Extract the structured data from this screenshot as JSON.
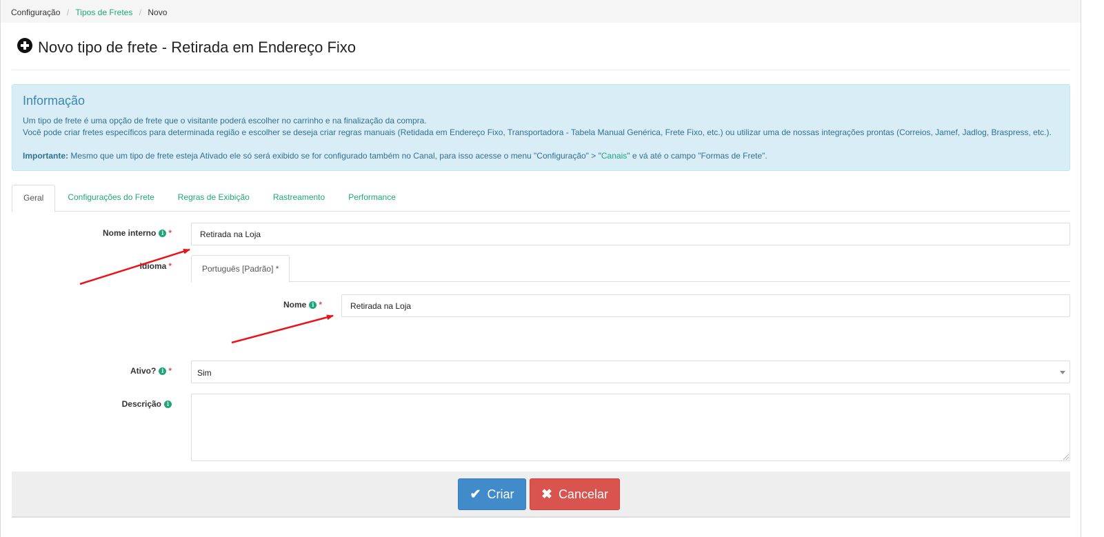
{
  "breadcrumb": {
    "items": [
      "Configuração",
      "Tipos de Fretes",
      "Novo"
    ]
  },
  "page": {
    "title": "Novo tipo de frete - Retirada em Endereço Fixo"
  },
  "info": {
    "title": "Informação",
    "line1": "Um tipo de frete é uma opção de frete que o visitante poderá escolher no carrinho e na finalização da compra.",
    "line2": "Você pode criar fretes específicos para determinada região e escolher se deseja criar regras manuais (Retidada em Endereço Fixo, Transportadora - Tabela Manual Genérica, Frete Fixo, etc.) ou utilizar uma de nossas integrações prontas (Correios, Jamef, Jadlog, Braspress, etc.).",
    "important_label": "Importante:",
    "important_text_a": " Mesmo que um tipo de frete esteja Ativado ele só será exibido se for configurado também no Canal, para isso acesse o menu \"Configuração\" > \"",
    "important_link": "Canais",
    "important_text_b": "\" e vá até o campo \"Formas de Frete\"."
  },
  "tabs": [
    "Geral",
    "Configurações do Frete",
    "Regras de Exibição",
    "Rastreamento",
    "Performance"
  ],
  "form": {
    "internal_name_label": "Nome interno",
    "internal_name_value": "Retirada na Loja",
    "language_label": "Idioma",
    "language_tab": "Português [Padrão] *",
    "name_label": "Nome",
    "name_value": "Retirada na Loja",
    "active_label": "Ativo?",
    "active_value": "Sim",
    "description_label": "Descrição",
    "description_value": "",
    "required_mark": "*",
    "info_icon_glyph": "i"
  },
  "actions": {
    "create_label": "Criar",
    "create_icon": "check-icon",
    "cancel_label": "Cancelar",
    "cancel_icon": "times-icon"
  },
  "colors": {
    "link": "#1fa67a",
    "info_bg": "#d9edf7",
    "primary": "#428bca",
    "danger": "#d9534f",
    "annotation_arrow": "#e8141b"
  }
}
